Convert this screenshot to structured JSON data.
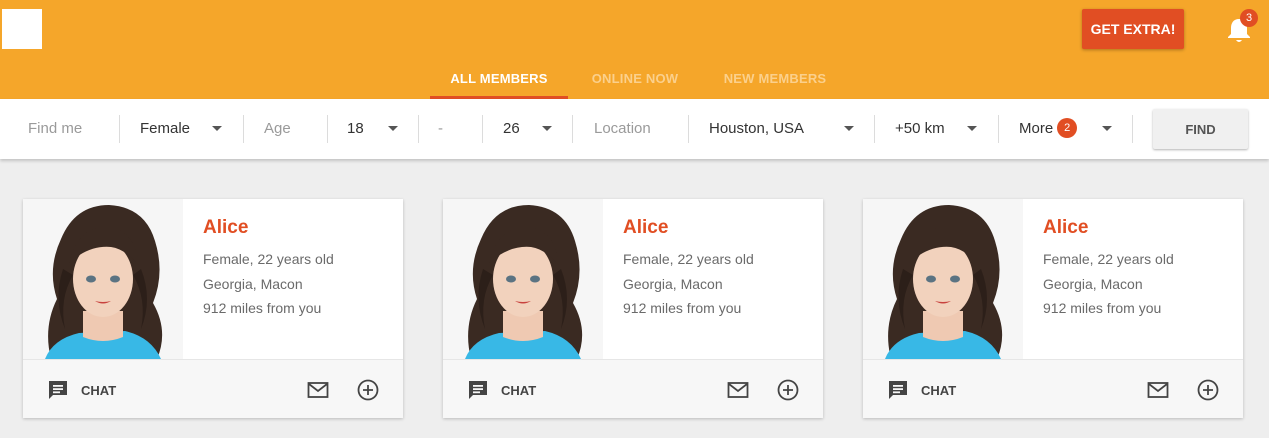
{
  "header": {
    "extra_label": "GET EXTRA!",
    "notifications_count": "3",
    "tabs": [
      {
        "label": "ALL MEMBERS"
      },
      {
        "label": "ONLINE NOW"
      },
      {
        "label": "NEW MEMBERS"
      }
    ]
  },
  "search": {
    "find_me_placeholder": "Find me",
    "gender": "Female",
    "age_placeholder": "Age",
    "age_from": "18",
    "age_sep": "-",
    "age_to": "26",
    "location_placeholder": "Location",
    "location": "Houston, USA",
    "distance": "+50 km",
    "more_label": "More",
    "more_count": "2",
    "find_label": "FIND"
  },
  "cards": [
    {
      "name": "Alice",
      "line1": "Female, 22 years old",
      "line2": "Georgia, Macon",
      "line3": "912 miles from you",
      "chat_label": "CHAT"
    },
    {
      "name": "Alice",
      "line1": "Female, 22 years old",
      "line2": "Georgia, Macon",
      "line3": "912 miles from you",
      "chat_label": "CHAT"
    },
    {
      "name": "Alice",
      "line1": "Female, 22 years old",
      "line2": "Georgia, Macon",
      "line3": "912 miles from you",
      "chat_label": "CHAT"
    }
  ],
  "colors": {
    "header": "#f5a62a",
    "accent": "#e14e23"
  },
  "icons": [
    "bell-icon",
    "chat-icon",
    "mail-icon",
    "add-circle-icon",
    "caret-down-icon"
  ]
}
